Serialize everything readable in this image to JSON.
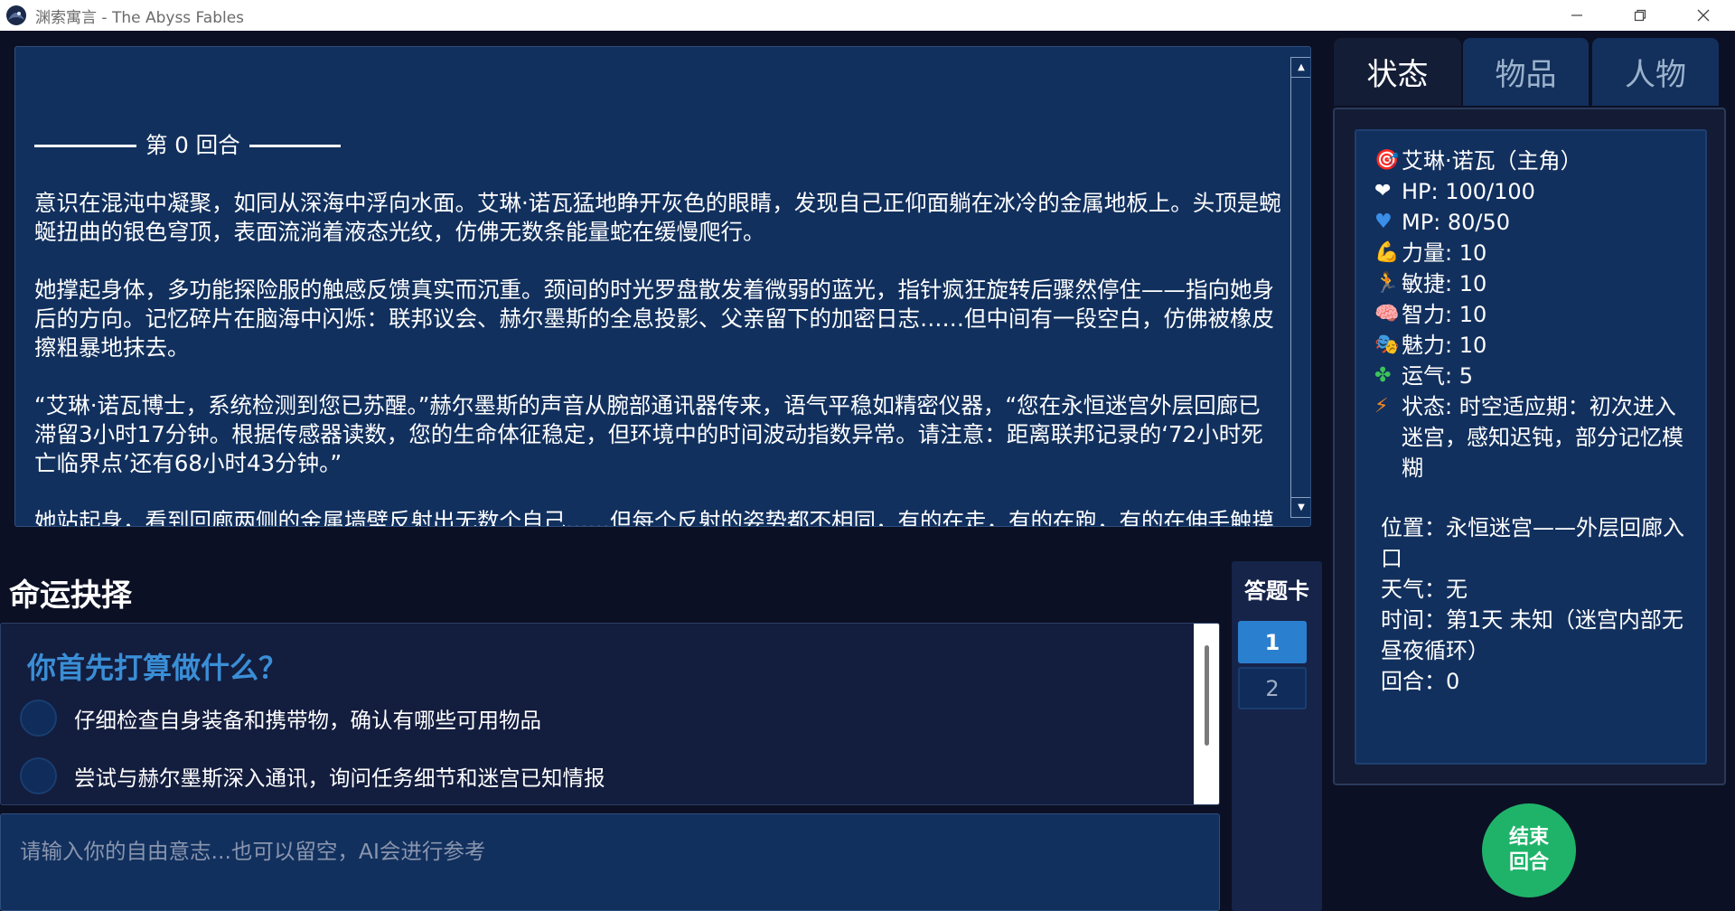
{
  "window": {
    "title": "渊索寓言 - The Abyss Fables",
    "minimize": "—",
    "maximize": "❐",
    "close": "✕"
  },
  "story": {
    "round_header": "第 0 回合",
    "paragraphs": [
      "意识在混沌中凝聚，如同从深海中浮向水面。艾琳·诺瓦猛地睁开灰色的眼睛，发现自己正仰面躺在冰冷的金属地板上。头顶是蜿蜒扭曲的银色穹顶，表面流淌着液态光纹，仿佛无数条能量蛇在缓慢爬行。",
      "她撑起身体，多功能探险服的触感反馈真实而沉重。颈间的时光罗盘散发着微弱的蓝光，指针疯狂旋转后骤然停住——指向她身后的方向。记忆碎片在脑海中闪烁：联邦议会、赫尔墨斯的全息投影、父亲留下的加密日志……但中间有一段空白，仿佛被橡皮擦粗暴地抹去。",
      "“艾琳·诺瓦博士，系统检测到您已苏醒。”赫尔墨斯的声音从腕部通讯器传来，语气平稳如精密仪器，“您在永恒迷宫外层回廊已滞留3小时17分钟。根据传感器读数，您的生命体征稳定，但环境中的时间波动指数异常。请注意：距离联邦记录的‘72小时死亡临界点’还有68小时43分钟。”",
      "她站起身，看到回廊两侧的金属墙壁反射出无数个自己……但每个反射的姿势都不相同，有的在走，有的在跑，有的在伸手触摸"
    ]
  },
  "choices": {
    "section_title": "命运抉择",
    "question": "你首先打算做什么？",
    "options": [
      "仔细检查自身装备和携带物，确认有哪些可用物品",
      "尝试与赫尔墨斯深入通讯，询问任务细节和迷宫已知情报"
    ],
    "free_input_placeholder": "请输入你的自由意志...也可以留空，AI会进行参考"
  },
  "answer_card": {
    "title": "答题卡",
    "items": [
      "1",
      "2"
    ],
    "selected": 1
  },
  "tabs": [
    "状态",
    "物品",
    "人物"
  ],
  "status": {
    "name": "艾琳·诺瓦（主角）",
    "hp": "HP: 100/100",
    "mp": "MP: 80/50",
    "strength": "力量: 10",
    "agility": "敏捷: 10",
    "intelligence": "智力: 10",
    "charm": "魅力: 10",
    "luck": "运气: 5",
    "condition": "状态: 时空适应期：初次进入迷宫，感知迟钝，部分记忆模糊",
    "location": "位置：永恒迷宫——外层回廊入口",
    "weather": "天气：无",
    "time": "时间：第1天 未知（迷宫内部无昼夜循环）",
    "round": "回合：0"
  },
  "end_turn": {
    "line1": "结束",
    "line2": "回合"
  },
  "colors": {
    "background": "#0c1024",
    "story_panel": "#11305e",
    "question_blue": "#3a8ed6",
    "active_answer": "#2b7fcf",
    "end_button": "#1fb36a"
  }
}
